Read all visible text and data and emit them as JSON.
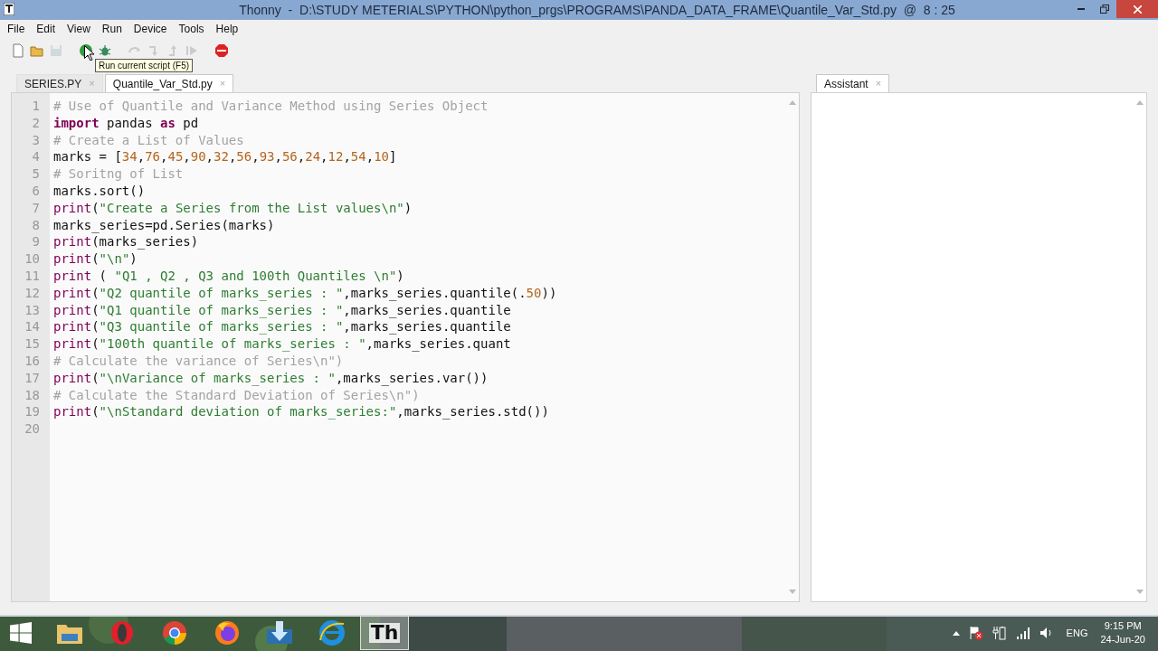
{
  "window": {
    "title": "Thonny  -  D:\\STUDY METERIALS\\PYTHON\\python_prgs\\PROGRAMS\\PANDA_DATA_FRAME\\Quantile_Var_Std.py  @  8 : 25"
  },
  "menu": [
    "File",
    "Edit",
    "View",
    "Run",
    "Device",
    "Tools",
    "Help"
  ],
  "toolbar": [
    {
      "kind": "new",
      "disabled": false
    },
    {
      "kind": "open",
      "disabled": false
    },
    {
      "kind": "save",
      "disabled": true
    },
    {
      "kind": "run",
      "disabled": false
    },
    {
      "kind": "debug",
      "disabled": false
    },
    {
      "kind": "step-over",
      "disabled": true
    },
    {
      "kind": "step-into",
      "disabled": true
    },
    {
      "kind": "step-out",
      "disabled": true
    },
    {
      "kind": "resume",
      "disabled": true
    },
    {
      "kind": "stop",
      "disabled": false
    }
  ],
  "tooltip": "Run current script (F5)",
  "editor_tabs": [
    {
      "label": "SERIES.PY",
      "close": "×",
      "selected": false
    },
    {
      "label": "Quantile_Var_Std.py",
      "close": "×",
      "selected": true
    }
  ],
  "lines": [
    {
      "number": "1",
      "tokens": [
        {
          "kind": "comment",
          "text": "# Use of Quantile and Variance Method using Series Object"
        }
      ]
    },
    {
      "number": "2",
      "tokens": [
        {
          "kind": "keyword",
          "text": "import"
        },
        {
          "kind": "plain",
          "text": " pandas "
        },
        {
          "kind": "keyword",
          "text": "as"
        },
        {
          "kind": "plain",
          "text": " pd"
        }
      ]
    },
    {
      "number": "3",
      "tokens": [
        {
          "kind": "comment",
          "text": "# Create a List of Values"
        }
      ]
    },
    {
      "number": "4",
      "tokens": [
        {
          "kind": "plain",
          "text": "marks = ["
        },
        {
          "kind": "number",
          "text": "34"
        },
        {
          "kind": "plain",
          "text": ","
        },
        {
          "kind": "number",
          "text": "76"
        },
        {
          "kind": "plain",
          "text": ","
        },
        {
          "kind": "number",
          "text": "45"
        },
        {
          "kind": "plain",
          "text": ","
        },
        {
          "kind": "number",
          "text": "90"
        },
        {
          "kind": "plain",
          "text": ","
        },
        {
          "kind": "number",
          "text": "32"
        },
        {
          "kind": "plain",
          "text": ","
        },
        {
          "kind": "number",
          "text": "56"
        },
        {
          "kind": "plain",
          "text": ","
        },
        {
          "kind": "number",
          "text": "93"
        },
        {
          "kind": "plain",
          "text": ","
        },
        {
          "kind": "number",
          "text": "56"
        },
        {
          "kind": "plain",
          "text": ","
        },
        {
          "kind": "number",
          "text": "24"
        },
        {
          "kind": "plain",
          "text": ","
        },
        {
          "kind": "number",
          "text": "12"
        },
        {
          "kind": "plain",
          "text": ","
        },
        {
          "kind": "number",
          "text": "54"
        },
        {
          "kind": "plain",
          "text": ","
        },
        {
          "kind": "number",
          "text": "10"
        },
        {
          "kind": "plain",
          "text": "]"
        }
      ]
    },
    {
      "number": "5",
      "tokens": [
        {
          "kind": "comment",
          "text": "# Soritng of List"
        }
      ]
    },
    {
      "number": "6",
      "tokens": [
        {
          "kind": "plain",
          "text": "marks.sort()"
        }
      ]
    },
    {
      "number": "7",
      "tokens": [
        {
          "kind": "builtin",
          "text": "print"
        },
        {
          "kind": "plain",
          "text": "("
        },
        {
          "kind": "string",
          "text": "\"Create a Series from the List values\\n\""
        },
        {
          "kind": "plain",
          "text": ")"
        }
      ]
    },
    {
      "number": "8",
      "tokens": [
        {
          "kind": "plain",
          "text": "marks_series=pd.Series(marks)"
        }
      ]
    },
    {
      "number": "9",
      "tokens": [
        {
          "kind": "builtin",
          "text": "print"
        },
        {
          "kind": "plain",
          "text": "(marks_series)"
        }
      ]
    },
    {
      "number": "10",
      "tokens": [
        {
          "kind": "builtin",
          "text": "print"
        },
        {
          "kind": "plain",
          "text": "("
        },
        {
          "kind": "string",
          "text": "\"\\n\""
        },
        {
          "kind": "plain",
          "text": ")"
        }
      ]
    },
    {
      "number": "11",
      "tokens": [
        {
          "kind": "builtin",
          "text": "print"
        },
        {
          "kind": "plain",
          "text": " ( "
        },
        {
          "kind": "string",
          "text": "\"Q1 , Q2 , Q3 and 100th Quantiles \\n\""
        },
        {
          "kind": "plain",
          "text": ")"
        }
      ]
    },
    {
      "number": "12",
      "tokens": [
        {
          "kind": "builtin",
          "text": "print"
        },
        {
          "kind": "plain",
          "text": "("
        },
        {
          "kind": "string",
          "text": "\"Q2 quantile of marks_series : \""
        },
        {
          "kind": "plain",
          "text": ",marks_series.quantile(."
        },
        {
          "kind": "number",
          "text": "50"
        },
        {
          "kind": "plain",
          "text": "))"
        }
      ]
    },
    {
      "number": "13",
      "tokens": [
        {
          "kind": "builtin",
          "text": "print"
        },
        {
          "kind": "plain",
          "text": "("
        },
        {
          "kind": "string",
          "text": "\"Q1 quantile of marks_series : \""
        },
        {
          "kind": "plain",
          "text": ",marks_series.quantile"
        }
      ]
    },
    {
      "number": "14",
      "tokens": [
        {
          "kind": "builtin",
          "text": "print"
        },
        {
          "kind": "plain",
          "text": "("
        },
        {
          "kind": "string",
          "text": "\"Q3 quantile of marks_series : \""
        },
        {
          "kind": "plain",
          "text": ",marks_series.quantile"
        }
      ]
    },
    {
      "number": "15",
      "tokens": [
        {
          "kind": "builtin",
          "text": "print"
        },
        {
          "kind": "plain",
          "text": "("
        },
        {
          "kind": "string",
          "text": "\"100th quantile of marks_series : \""
        },
        {
          "kind": "plain",
          "text": ",marks_series.quant"
        }
      ]
    },
    {
      "number": "16",
      "tokens": [
        {
          "kind": "comment",
          "text": "# Calculate the variance of Series\\n\")"
        }
      ]
    },
    {
      "number": "17",
      "tokens": [
        {
          "kind": "builtin",
          "text": "print"
        },
        {
          "kind": "plain",
          "text": "("
        },
        {
          "kind": "string",
          "text": "\"\\nVariance of marks_series : \""
        },
        {
          "kind": "plain",
          "text": ",marks_series.var())"
        }
      ]
    },
    {
      "number": "18",
      "tokens": [
        {
          "kind": "comment",
          "text": "# Calculate the Standard Deviation of Series\\n\")"
        }
      ]
    },
    {
      "number": "19",
      "tokens": [
        {
          "kind": "builtin",
          "text": "print"
        },
        {
          "kind": "plain",
          "text": "("
        },
        {
          "kind": "string",
          "text": "\"\\nStandard deviation of marks_series:\""
        },
        {
          "kind": "plain",
          "text": ",marks_series.std())"
        }
      ]
    },
    {
      "number": "20"
    }
  ],
  "assistant_tab": {
    "label": "Assistant",
    "close": "×",
    "selected": true
  },
  "taskbar": {
    "apps": [
      {
        "kind": "folder",
        "selected": false
      },
      {
        "kind": "opera",
        "selected": false
      },
      {
        "kind": "chrome",
        "selected": false
      },
      {
        "kind": "firefox",
        "selected": false
      },
      {
        "kind": "installer",
        "selected": false
      },
      {
        "kind": "ie",
        "selected": false
      },
      {
        "kind": "thonny",
        "label": "Th",
        "selected": true
      }
    ],
    "tray": {
      "language": "ENG",
      "time": "9:15 PM",
      "date": "24-Jun-20"
    }
  }
}
